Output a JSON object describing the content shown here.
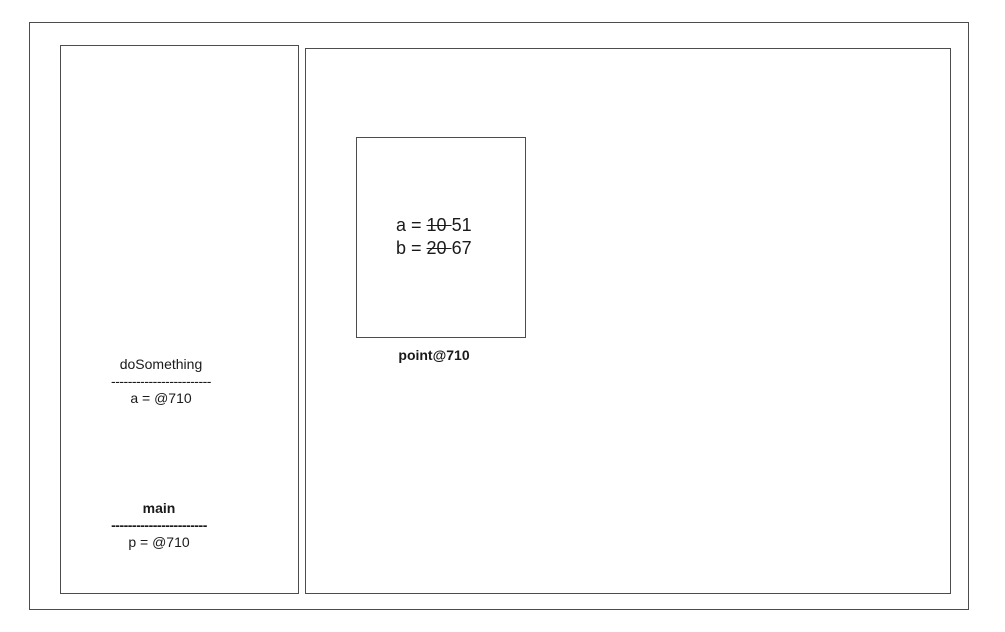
{
  "stack": {
    "frames": [
      {
        "name": "doSomething",
        "separator": "------------------------",
        "variable": "a = @710"
      },
      {
        "name": "main",
        "separator": "-----------------------",
        "variable": "p = @710"
      }
    ]
  },
  "heap": {
    "object": {
      "label": "point@710",
      "fields": [
        {
          "prefix": "a = ",
          "old": "10 ",
          "new": "51"
        },
        {
          "prefix": "b = ",
          "old": "20 ",
          "new": "67"
        }
      ]
    }
  }
}
